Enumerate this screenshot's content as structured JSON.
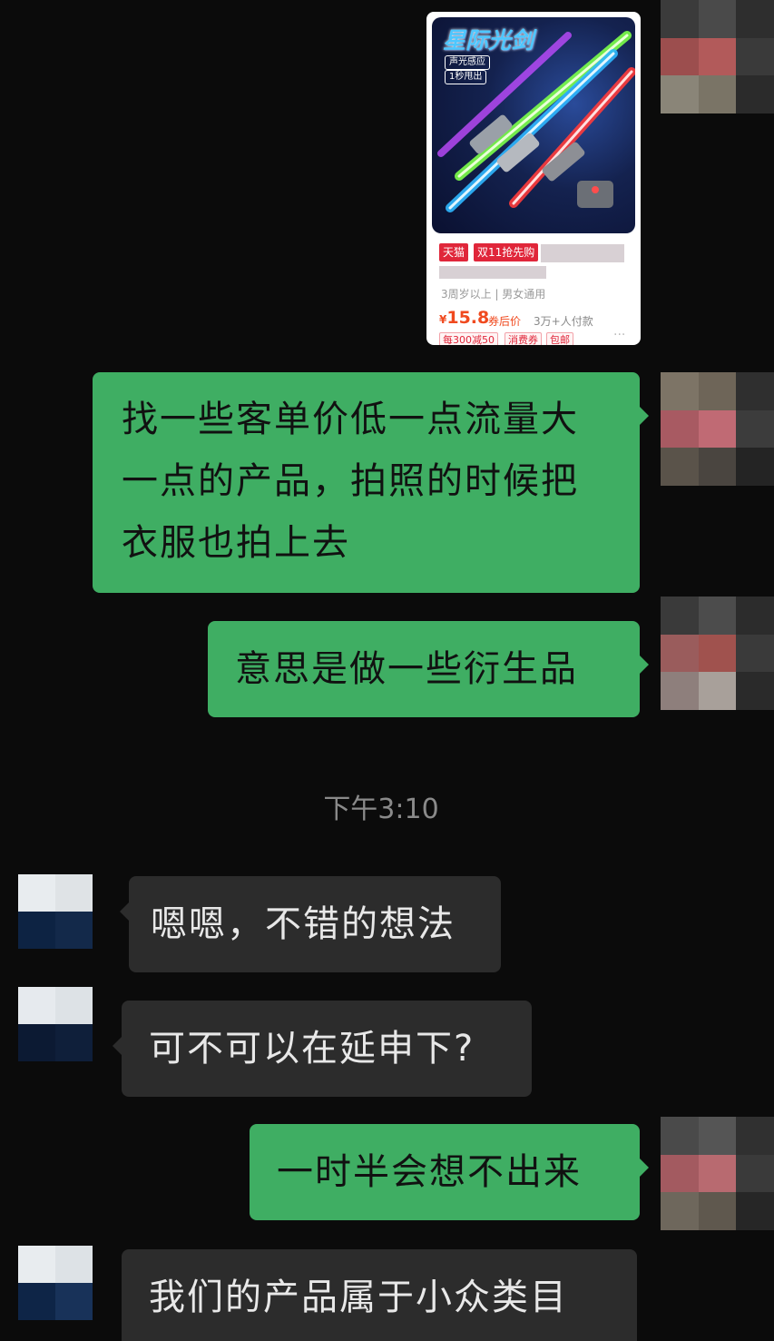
{
  "product_card": {
    "image_title": "星际光剑",
    "image_tags": [
      "声光感应",
      "1秒甩出"
    ],
    "badges": [
      "天猫",
      "双11抢先购"
    ],
    "meta": "3周岁以上 | 男女通用",
    "price_symbol": "¥",
    "price": "15.8",
    "price_note": "券后价",
    "sales": "3万+人付款",
    "coupons": [
      "每300减50",
      "消费券",
      "包邮"
    ],
    "more_icon": "···"
  },
  "messages": [
    {
      "side": "right",
      "text": "找一些客单价低一点流量大一点的产品，拍照的时候把衣服也拍上去"
    },
    {
      "side": "right",
      "text": "意思是做一些衍生品"
    },
    {
      "side": "left",
      "text": "嗯嗯，不错的想法"
    },
    {
      "side": "left",
      "text": "可不可以在延申下?"
    },
    {
      "side": "right",
      "text": "一时半会想不出来"
    },
    {
      "side": "left",
      "text": "我们的产品属于小众类目"
    }
  ],
  "timestamp": "下午3:10",
  "colors": {
    "background": "#0b0b0b",
    "outgoing_bubble": "#3fae63",
    "incoming_bubble": "#2c2c2c",
    "price": "#f04a1f",
    "badge": "#e0263a"
  }
}
